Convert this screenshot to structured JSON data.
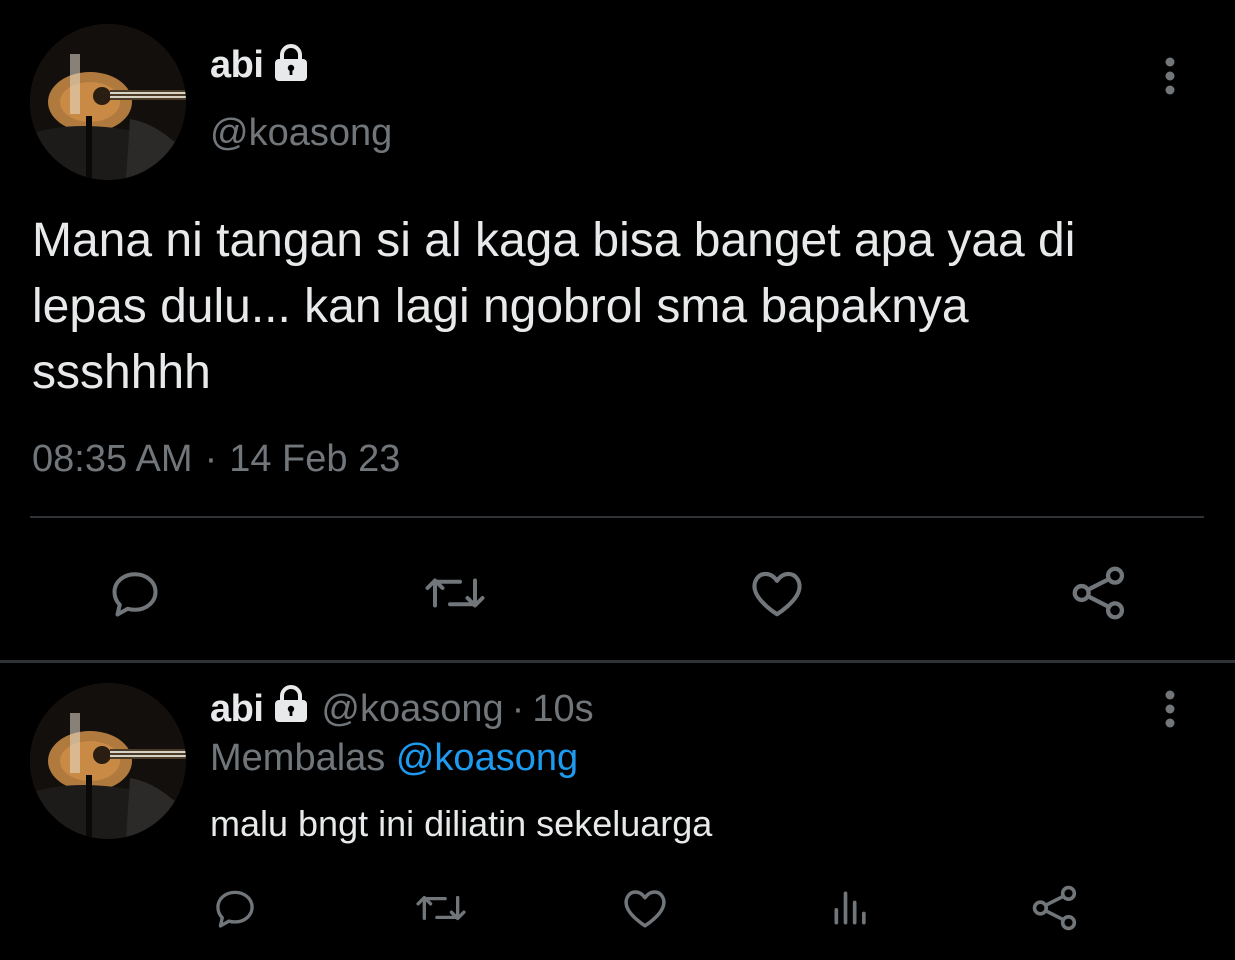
{
  "main_tweet": {
    "author": {
      "display_name": "abi",
      "handle": "@koasong",
      "avatar_icon": "guitar-avatar",
      "protected_icon": "lock-icon"
    },
    "text_lines": [
      "Mana ni tangan si al kaga bisa banget apa yaa di",
      "lepas dulu... kan lagi ngobrol sma bapaknya",
      "ssshhhh"
    ],
    "time": "08:35 AM",
    "separator": "·",
    "date": "14 Feb 23",
    "actions": [
      "reply-icon",
      "retweet-icon",
      "like-icon",
      "share-icon"
    ]
  },
  "reply": {
    "author": {
      "display_name": "abi",
      "handle": "@koasong",
      "protected_icon": "lock-icon"
    },
    "separator": "·",
    "age": "10s",
    "replying_label": "Membalas",
    "replying_to": "@koasong",
    "text": "malu bngt ini diliatin sekeluarga",
    "actions": [
      "reply-icon",
      "retweet-icon",
      "like-icon",
      "views-icon",
      "share-icon"
    ]
  },
  "colors": {
    "background": "#000000",
    "primary_text": "#e7e9ea",
    "secondary_text": "#71767b",
    "accent": "#1d9bf0",
    "divider": "#2f3336"
  }
}
